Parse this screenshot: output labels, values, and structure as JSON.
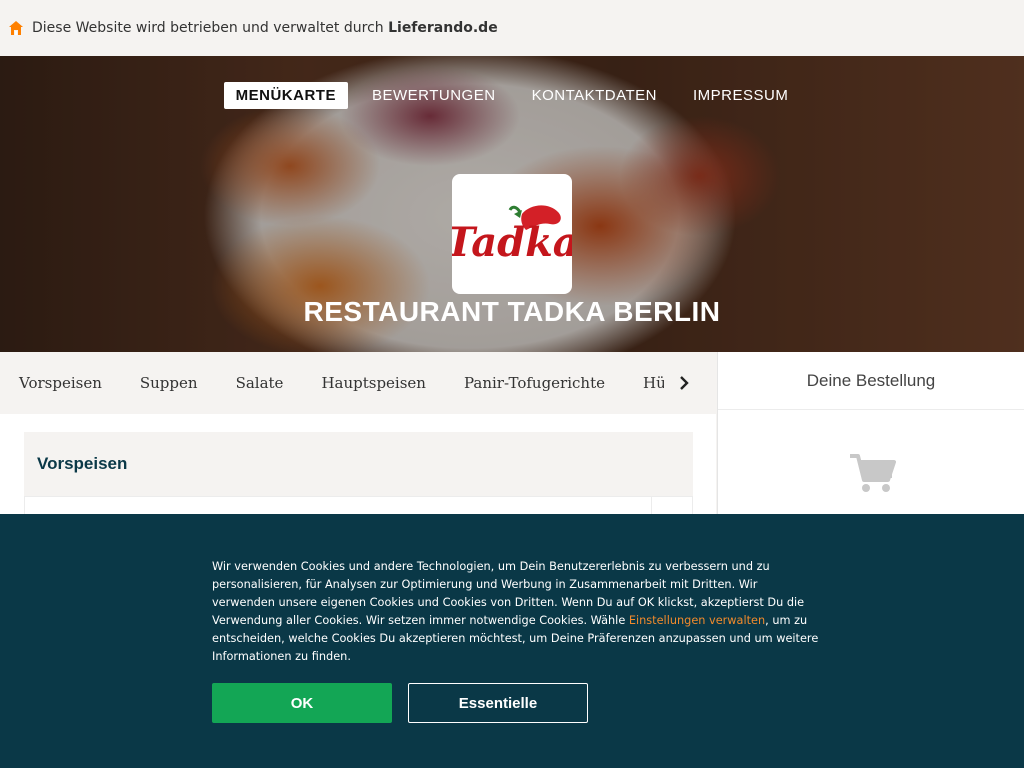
{
  "topbar": {
    "prefix": "Diese Website wird betrieben und verwaltet durch ",
    "brand": "Lieferando.de",
    "icon": "house-icon"
  },
  "nav": {
    "items": [
      {
        "label": "MENÜKARTE",
        "active": true
      },
      {
        "label": "BEWERTUNGEN",
        "active": false
      },
      {
        "label": "KONTAKTDATEN",
        "active": false
      },
      {
        "label": "IMPRESSUM",
        "active": false
      }
    ]
  },
  "restaurant": {
    "logo_text": "Tadka",
    "name": "RESTAURANT TADKA BERLIN"
  },
  "categories": {
    "items": [
      "Vorspeisen",
      "Suppen",
      "Salate",
      "Hauptspeisen",
      "Panir-Tofugerichte",
      "Hühnerfle"
    ],
    "next_icon": "chevron-right-icon"
  },
  "main": {
    "section_title": "Vorspeisen"
  },
  "basket": {
    "title": "Deine Bestellung",
    "icon": "shopping-cart-icon"
  },
  "cookie": {
    "text_before": "Wir verwenden Cookies und andere Technologien, um Dein Benutzererlebnis zu verbessern und zu personalisieren, für Analysen zur Optimierung und Werbung in Zusammenarbeit mit Dritten. Wir verwenden unsere eigenen Cookies und Cookies von Dritten. Wenn Du auf OK klickst, akzeptierst Du die Verwendung aller Cookies. Wir setzen immer notwendige Cookies. Wähle ",
    "link": "Einstellungen verwalten",
    "text_after": ", um zu entscheiden, welche Cookies Du akzeptieren möchtest, um Deine Präferenzen anzupassen und um weitere Informationen zu finden.",
    "ok_label": "OK",
    "essential_label": "Essentielle"
  },
  "colors": {
    "banner_bg": "#0a3847",
    "ok_green": "#13a655",
    "link_orange": "#f18a2c",
    "brand_orange": "#ff8000"
  }
}
